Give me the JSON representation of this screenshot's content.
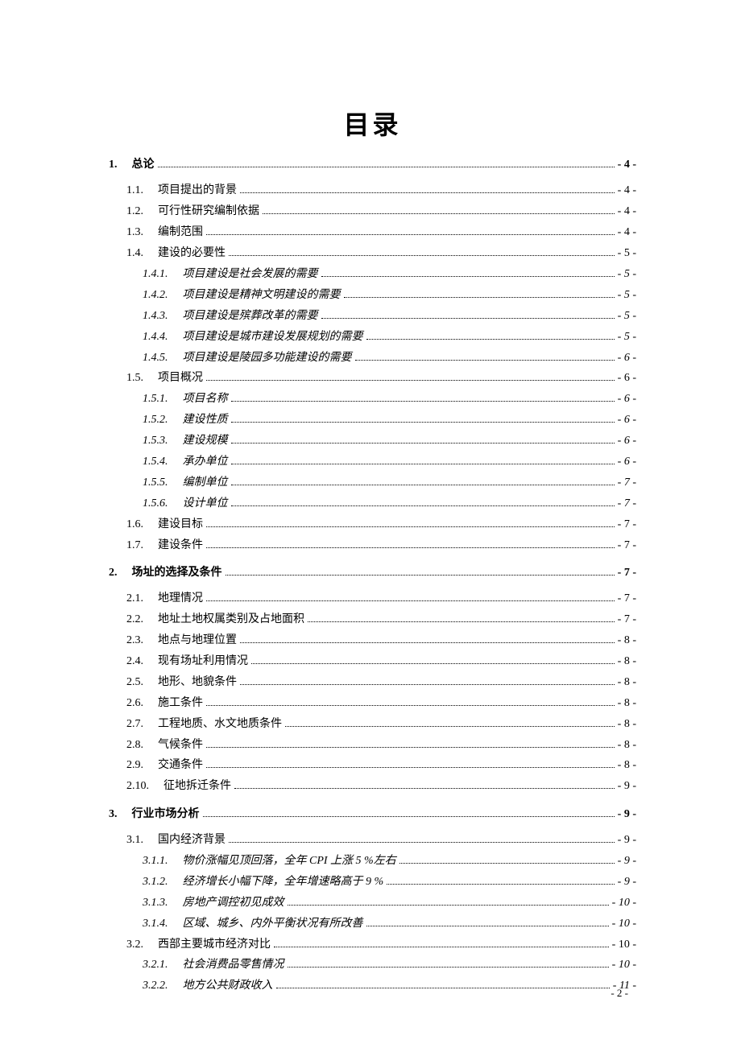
{
  "title": "目录",
  "page_footer": "- 2 -",
  "entries": [
    {
      "level": "sec",
      "num": "1.",
      "txt": "总论",
      "page": "- 4 -"
    },
    {
      "level": "sub",
      "num": "1.1.",
      "txt": "项目提出的背景",
      "page": "- 4 -"
    },
    {
      "level": "sub",
      "num": "1.2.",
      "txt": "可行性研究编制依据",
      "page": "- 4 -"
    },
    {
      "level": "sub",
      "num": "1.3.",
      "txt": "编制范围",
      "page": "- 4 -"
    },
    {
      "level": "sub",
      "num": "1.4.",
      "txt": "建设的必要性",
      "page": "- 5 -"
    },
    {
      "level": "subsub",
      "num": "1.4.1.",
      "txt": "项目建设是社会发展的需要",
      "page": "- 5 -"
    },
    {
      "level": "subsub",
      "num": "1.4.2.",
      "txt": "项目建设是精神文明建设的需要",
      "page": "- 5 -"
    },
    {
      "level": "subsub",
      "num": "1.4.3.",
      "txt": "项目建设是殡葬改革的需要",
      "page": "- 5 -"
    },
    {
      "level": "subsub",
      "num": "1.4.4.",
      "txt": "项目建设是城市建设发展规划的需要",
      "page": "- 5 -"
    },
    {
      "level": "subsub",
      "num": "1.4.5.",
      "txt": "项目建设是陵园多功能建设的需要",
      "page": "- 6 -"
    },
    {
      "level": "sub",
      "num": "1.5.",
      "txt": "项目概况",
      "page": "- 6 -"
    },
    {
      "level": "subsub",
      "num": "1.5.1.",
      "txt": "项目名称",
      "page": "- 6 -"
    },
    {
      "level": "subsub",
      "num": "1.5.2.",
      "txt": "建设性质",
      "page": "- 6 -"
    },
    {
      "level": "subsub",
      "num": "1.5.3.",
      "txt": "建设规模",
      "page": "- 6 -"
    },
    {
      "level": "subsub",
      "num": "1.5.4.",
      "txt": "承办单位",
      "page": "- 6 -"
    },
    {
      "level": "subsub",
      "num": "1.5.5.",
      "txt": "编制单位",
      "page": "- 7 -"
    },
    {
      "level": "subsub",
      "num": "1.5.6.",
      "txt": "设计单位",
      "page": "- 7 -"
    },
    {
      "level": "sub",
      "num": "1.6.",
      "txt": "建设目标",
      "page": "- 7 -"
    },
    {
      "level": "sub",
      "num": "1.7.",
      "txt": "建设条件",
      "page": "- 7 -"
    },
    {
      "level": "sec",
      "num": "2.",
      "txt": "场址的选择及条件",
      "page": "- 7 -"
    },
    {
      "level": "sub",
      "num": "2.1.",
      "txt": "地理情况",
      "page": "- 7 -"
    },
    {
      "level": "sub",
      "num": "2.2.",
      "txt": "地址土地权属类别及占地面积",
      "page": "- 7 -"
    },
    {
      "level": "sub",
      "num": "2.3.",
      "txt": "地点与地理位置",
      "page": "- 8 -"
    },
    {
      "level": "sub",
      "num": "2.4.",
      "txt": "现有场址利用情况",
      "page": "- 8 -"
    },
    {
      "level": "sub",
      "num": "2.5.",
      "txt": "地形、地貌条件",
      "page": "- 8 -"
    },
    {
      "level": "sub",
      "num": "2.6.",
      "txt": "施工条件",
      "page": "- 8 -"
    },
    {
      "level": "sub",
      "num": "2.7.",
      "txt": "工程地质、水文地质条件",
      "page": "- 8 -"
    },
    {
      "level": "sub",
      "num": "2.8.",
      "txt": "气候条件",
      "page": "- 8 -"
    },
    {
      "level": "sub",
      "num": "2.9.",
      "txt": "交通条件",
      "page": "- 8 -"
    },
    {
      "level": "sub",
      "num": "2.10.",
      "txt": "征地拆迁条件",
      "page": "- 9 -"
    },
    {
      "level": "sec",
      "num": "3.",
      "txt": "行业市场分析",
      "page": "- 9 -"
    },
    {
      "level": "sub",
      "num": "3.1.",
      "txt": "国内经济背景",
      "page": "- 9 -"
    },
    {
      "level": "subsub",
      "num": "3.1.1.",
      "txt": "物价涨幅见顶回落，全年 CPI 上涨 5 %左右",
      "page": "- 9 -"
    },
    {
      "level": "subsub",
      "num": "3.1.2.",
      "txt": "经济增长小幅下降，全年增速略高于 9 %",
      "page": "- 9 -"
    },
    {
      "level": "subsub",
      "num": "3.1.3.",
      "txt": "房地产调控初见成效",
      "page": "- 10 -"
    },
    {
      "level": "subsub",
      "num": "3.1.4.",
      "txt": "区域、城乡、内外平衡状况有所改善",
      "page": "- 10 -"
    },
    {
      "level": "sub",
      "num": "3.2.",
      "txt": "西部主要城市经济对比",
      "page": "- 10 -"
    },
    {
      "level": "subsub",
      "num": "3.2.1.",
      "txt": "社会消费品零售情况",
      "page": "- 10 -"
    },
    {
      "level": "subsub",
      "num": "3.2.2.",
      "txt": "地方公共财政收入",
      "page": "- 11 -"
    }
  ]
}
